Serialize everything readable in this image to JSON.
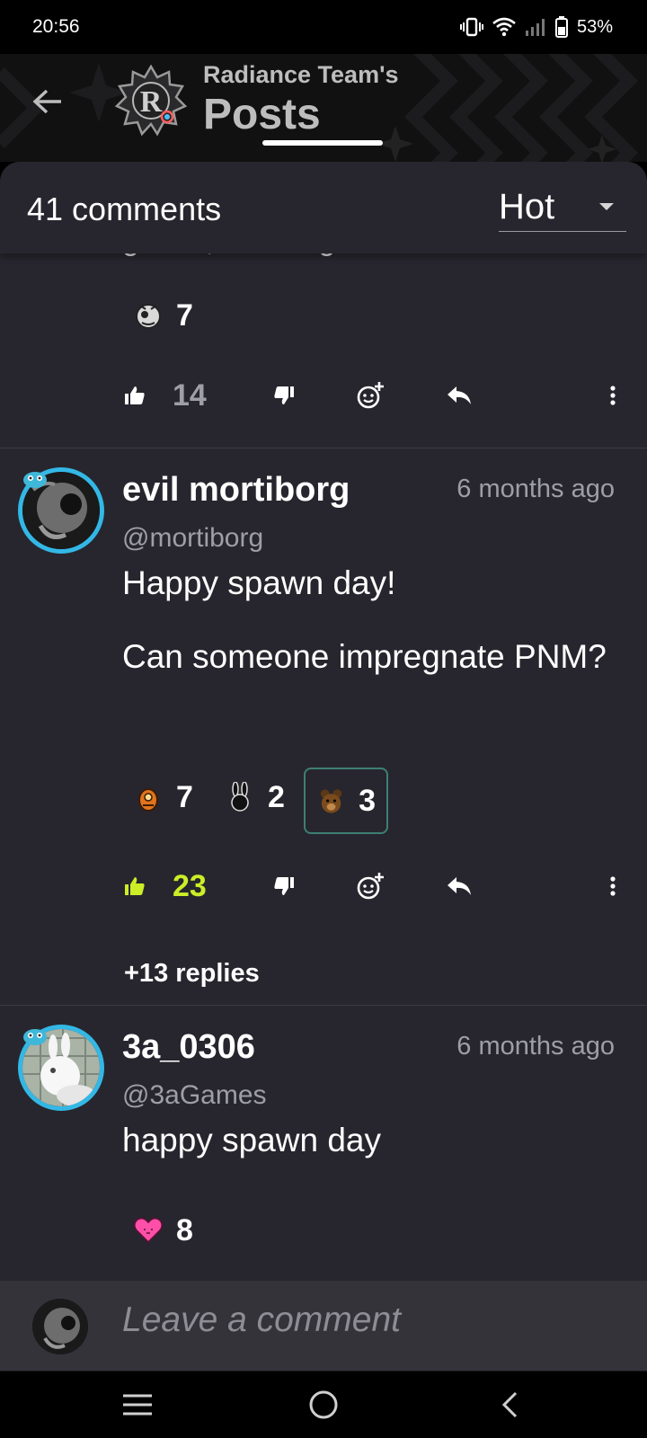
{
  "status_bar": {
    "time": "20:56",
    "battery": "53%"
  },
  "header": {
    "team_name": "Radiance Team's",
    "title": "Posts"
  },
  "comments_header": {
    "count_label": "41 comments",
    "sort_value": "Hot"
  },
  "previous_comment": {
    "reactions": [
      {
        "icon": "mortiborg-emoji-icon",
        "count": "7"
      }
    ],
    "upvotes": "14"
  },
  "comments": [
    {
      "username": "evil mortiborg",
      "handle": "@mortiborg",
      "time": "6 months ago",
      "paragraphs": [
        "Happy spawn day!",
        "Can someone impregnate PNM?"
      ],
      "reactions": [
        {
          "icon": "orange-creature-emoji-icon",
          "count": "7"
        },
        {
          "icon": "bunny-emoji-icon",
          "count": "2"
        },
        {
          "icon": "bear-emoji-icon",
          "count": "3",
          "selected": true
        }
      ],
      "upvotes": "23",
      "upvote_active": true,
      "replies_label": "+13 replies"
    },
    {
      "username": "3a_0306",
      "handle": "@3aGames",
      "time": "6 months ago",
      "paragraphs": [
        "happy spawn day"
      ],
      "reactions": [
        {
          "icon": "pink-heart-emoji-icon",
          "count": "8"
        }
      ]
    }
  ],
  "composer": {
    "placeholder": "Leave a comment"
  },
  "colors": {
    "accent_upvote": "#cbee27",
    "avatar_ring": "#33b8e6",
    "background": "#27262e"
  }
}
